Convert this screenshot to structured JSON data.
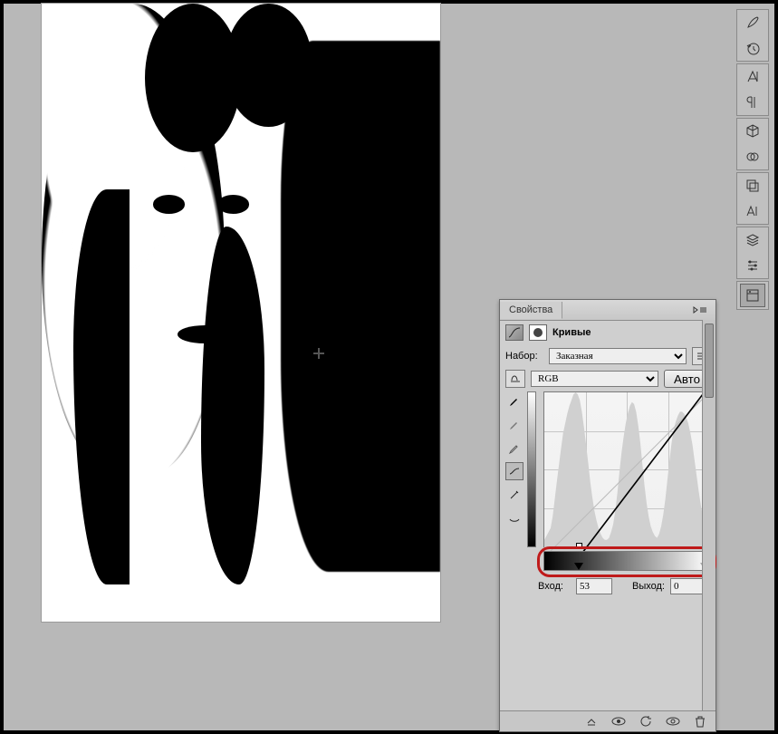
{
  "panel": {
    "title": "Свойства",
    "section_label": "Кривые",
    "preset_label": "Набор:",
    "preset_value": "Заказная",
    "channel_value": "RGB",
    "auto_label": "Авто",
    "input_label": "Вход:",
    "input_value": "53",
    "output_label": "Выход:",
    "output_value": "0"
  },
  "curve": {
    "black_point_x_pct": 21,
    "white_point_x_pct": 97,
    "histogram": [
      18,
      22,
      26,
      30,
      42,
      60,
      78,
      95,
      112,
      128,
      138,
      148,
      156,
      162,
      168,
      170,
      168,
      162,
      150,
      134,
      116,
      98,
      78,
      62,
      48,
      38,
      30,
      24,
      20,
      18,
      18,
      20,
      26,
      34,
      48,
      66,
      88,
      108,
      124,
      138,
      148,
      156,
      160,
      158,
      150,
      136,
      118,
      96,
      74,
      56,
      42,
      32,
      26,
      22,
      20,
      24,
      32,
      44,
      60,
      80,
      100,
      118,
      132,
      140,
      146,
      150,
      150,
      148,
      144,
      138,
      128,
      116,
      100,
      84,
      68,
      54,
      42,
      34,
      28,
      24
    ]
  },
  "dock": {
    "groups": [
      [
        "brush-icon",
        "history-icon"
      ],
      [
        "character-icon",
        "paragraph-icon"
      ],
      [
        "cube-3d-icon",
        "materials-icon"
      ],
      [
        "layers-comp-icon",
        "char-styles-icon"
      ],
      [
        "layers-icon",
        "adjust-icon"
      ],
      [
        "properties-icon"
      ]
    ]
  }
}
